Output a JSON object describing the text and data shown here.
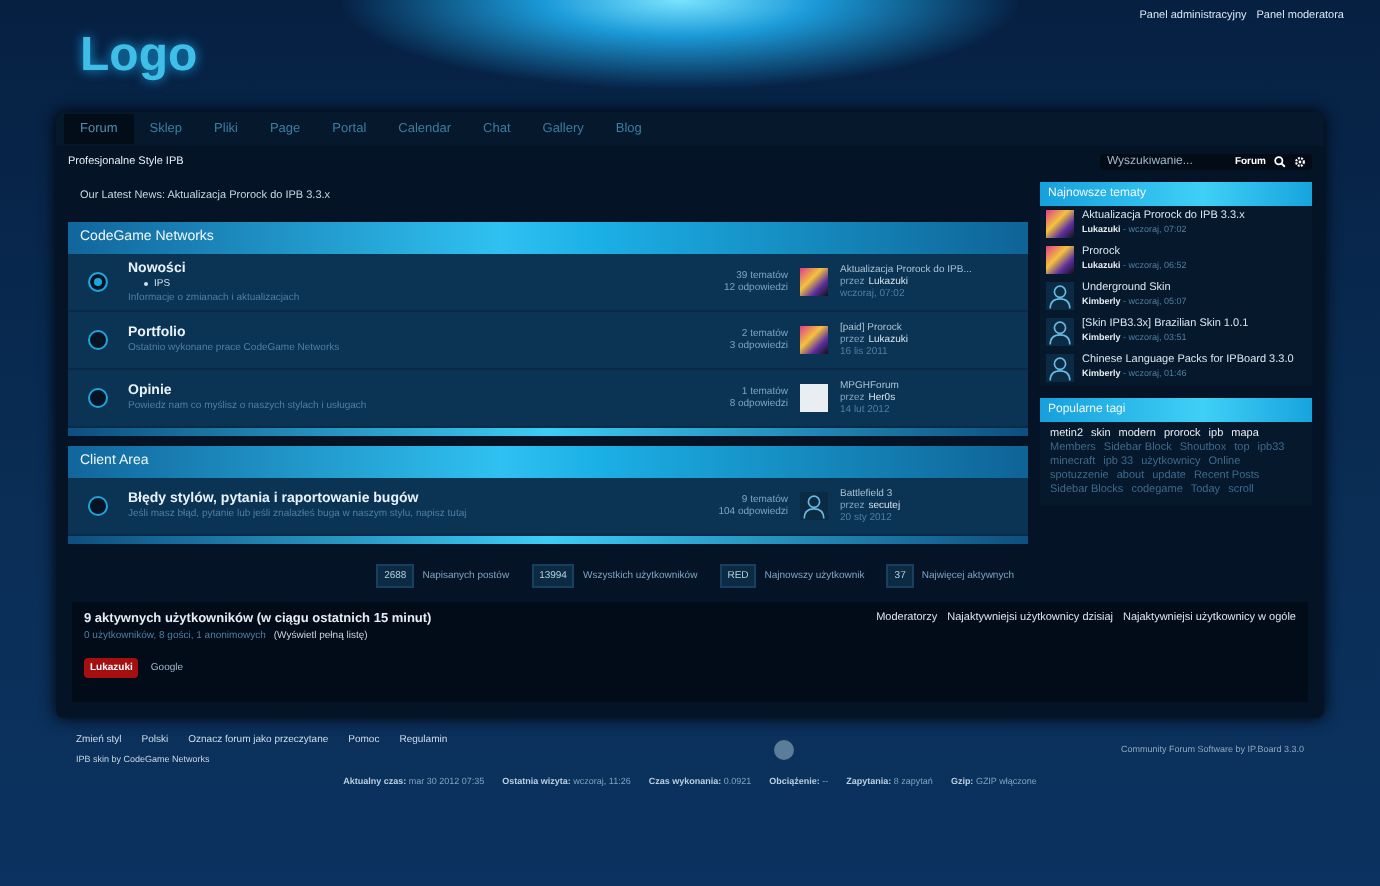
{
  "header": {
    "logo": "Logo",
    "user_links": [
      "Panel administracyjny",
      "Panel moderatora"
    ]
  },
  "nav": {
    "tabs": [
      {
        "label": "Forum",
        "selected": true
      },
      {
        "label": "Sklep",
        "selected": false
      },
      {
        "label": "Pliki",
        "selected": false
      },
      {
        "label": "Page",
        "selected": false
      },
      {
        "label": "Portal",
        "selected": false
      },
      {
        "label": "Calendar",
        "selected": false
      },
      {
        "label": "Chat",
        "selected": false
      },
      {
        "label": "Gallery",
        "selected": false
      },
      {
        "label": "Blog",
        "selected": false
      }
    ],
    "tagline": "Profesjonalne Style IPB"
  },
  "search": {
    "placeholder": "Wyszukiwanie...",
    "scope": "Forum"
  },
  "news": "Our Latest News: Aktualizacja Prorock do IPB 3.3.x",
  "categories": [
    {
      "title": "CodeGame Networks",
      "forums": [
        {
          "name": "Nowości",
          "unread": true,
          "subforums": [
            "IPS"
          ],
          "description": "Informacje o zmianach i aktualizacjach",
          "topics": "39 tematów",
          "replies": "12 odpowiedzi",
          "last_title": "Aktualizacja Prorock do IPB...",
          "last_by": "przez",
          "last_author": "Lukazuki",
          "last_date": "wczoraj, 07:02",
          "avatar": {
            "kind": "colorful"
          }
        },
        {
          "name": "Portfolio",
          "unread": false,
          "description": "Ostatnio wykonane prace CodeGame Networks",
          "topics": "2 tematów",
          "replies": "3 odpowiedzi",
          "last_title": "[paid] Prorock",
          "last_by": "przez",
          "last_author": "Lukazuki",
          "last_date": "16 lis 2011",
          "avatar": {
            "kind": "colorful"
          }
        },
        {
          "name": "Opinie",
          "unread": false,
          "description": "Powiedz nam co myślisz o naszych stylach i usługach",
          "topics": "1 tematów",
          "replies": "8 odpowiedzi",
          "last_title": "MPGHForum",
          "last_by": "przez",
          "last_author": "Her0s",
          "last_date": "14 lut 2012",
          "avatar": {
            "kind": "light"
          }
        }
      ]
    },
    {
      "title": "Client Area",
      "forums": [
        {
          "name": "Błędy stylów, pytania i raportowanie bugów",
          "unread": false,
          "description": "Jeśli masz błąd, pytanie lub jeśli znalazłeś buga w naszym stylu, napisz tutaj",
          "topics": "9 tematów",
          "replies": "104 odpowiedzi",
          "last_title": "Battlefield 3",
          "last_by": "przez",
          "last_author": "secutej",
          "last_date": "20 sty 2012",
          "avatar": {
            "kind": "silhouette"
          }
        }
      ]
    }
  ],
  "stats": [
    {
      "value": "2688",
      "label": "Napisanych postów"
    },
    {
      "value": "13994",
      "label": "Wszystkich użytkowników"
    },
    {
      "value": "RED",
      "label": "Najnowszy użytkownik"
    },
    {
      "value": "37",
      "label": "Najwięcej aktywnych"
    }
  ],
  "online": {
    "title": "9 aktywnych użytkowników (w ciągu ostatnich 15 minut)",
    "summary": "0 użytkowników, 8 gości, 1 anonimowych",
    "full_list": "(Wyświetl pełną listę)",
    "users": [
      {
        "name": "Lukazuki",
        "kind": "admin"
      },
      {
        "name": "Google",
        "kind": "bot"
      }
    ],
    "links": [
      "Moderatorzy",
      "Najaktywniejsi użytkownicy dzisiaj",
      "Najaktywniejsi użytkownicy w ogóle"
    ]
  },
  "sidebar": {
    "latest": {
      "title": "Najnowsze tematy",
      "items": [
        {
          "title": "Aktualizacja Prorock do IPB 3.3.x",
          "author": "Lukazuki",
          "time": "- wczoraj, 07:02",
          "avatar": {
            "kind": "colorful"
          }
        },
        {
          "title": "Prorock",
          "author": "Lukazuki",
          "time": "- wczoraj, 06:52",
          "avatar": {
            "kind": "colorful"
          }
        },
        {
          "title": "Underground Skin",
          "author": "Kimberly",
          "time": "- wczoraj, 05:07",
          "avatar": {
            "kind": "silhouette"
          }
        },
        {
          "title": "[Skin IPB3.3x] Brazilian Skin 1.0.1",
          "author": "Kimberly",
          "time": "- wczoraj, 03:51",
          "avatar": {
            "kind": "silhouette"
          }
        },
        {
          "title": "Chinese Language Packs for IPBoard 3.3.0",
          "author": "Kimberly",
          "time": "- wczoraj, 01:46",
          "avatar": {
            "kind": "silhouette"
          }
        }
      ]
    },
    "tags": {
      "title": "Popularne tagi",
      "items": [
        {
          "label": "metin2",
          "hot": true
        },
        {
          "label": "skin",
          "hot": true
        },
        {
          "label": "modern",
          "hot": true
        },
        {
          "label": "prorock",
          "hot": true
        },
        {
          "label": "ipb",
          "hot": true
        },
        {
          "label": "mapa",
          "hot": true
        },
        {
          "label": "Members",
          "hot": false
        },
        {
          "label": "Sidebar Block",
          "hot": false
        },
        {
          "label": "Shoutbox",
          "hot": false
        },
        {
          "label": "top",
          "hot": false
        },
        {
          "label": "ipb33",
          "hot": false
        },
        {
          "label": "minecraft",
          "hot": false
        },
        {
          "label": "ipb 33",
          "hot": false
        },
        {
          "label": "użytkownicy",
          "hot": false
        },
        {
          "label": "Online",
          "hot": false
        },
        {
          "label": "spotuzzenie",
          "hot": false
        },
        {
          "label": "about",
          "hot": false
        },
        {
          "label": "update",
          "hot": false
        },
        {
          "label": "Recent Posts",
          "hot": false
        },
        {
          "label": "Sidebar Blocks",
          "hot": false
        },
        {
          "label": "codegame",
          "hot": false
        },
        {
          "label": "Today",
          "hot": false
        },
        {
          "label": "scroll",
          "hot": false
        }
      ]
    }
  },
  "footer": {
    "links": [
      "Zmień styl",
      "Polski",
      "Oznacz forum jako przeczytane",
      "Pomoc",
      "Regulamin"
    ],
    "credit": "IPB skin by CodeGame Networks",
    "powered": "Community Forum Software by IP.Board 3.3.0",
    "stats": [
      {
        "label": "Aktualny czas:",
        "value": "mar 30 2012 07:35"
      },
      {
        "label": "Ostatnia wizyta:",
        "value": "wczoraj, 11:26"
      },
      {
        "label": "Czas wykonania:",
        "value": "0.0921"
      },
      {
        "label": "Obciążenie:",
        "value": "--"
      },
      {
        "label": "Zapytania:",
        "value": "8 zapytań"
      },
      {
        "label": "Gzip:",
        "value": "GZIP włączone"
      }
    ]
  }
}
